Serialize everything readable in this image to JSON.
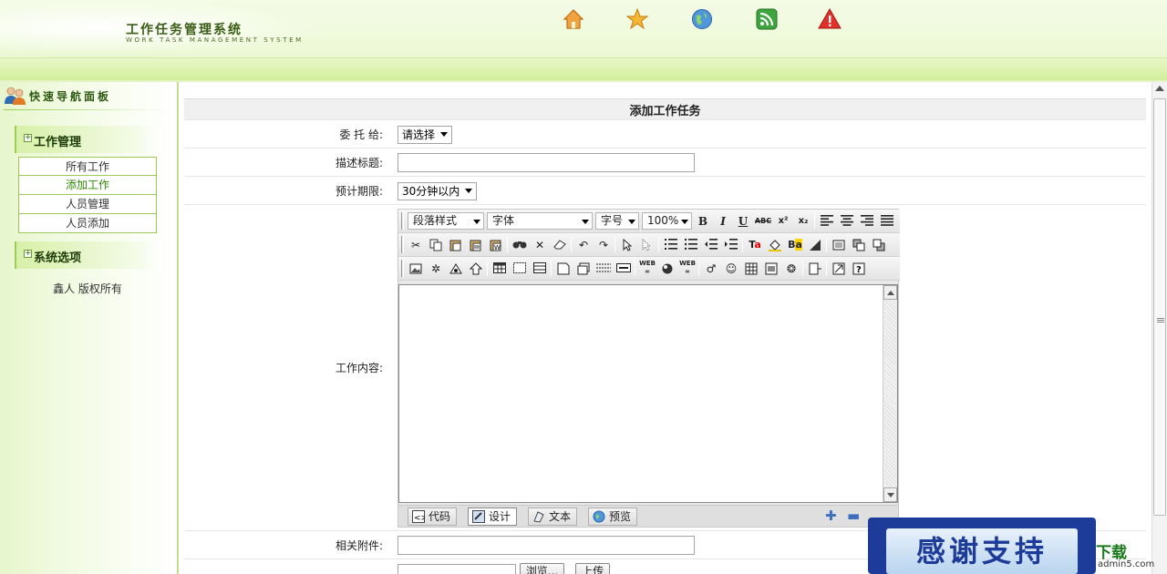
{
  "header": {
    "title": "工作任务管理系统",
    "subtitle": "WORK TASK MANAGEMENT SYSTEM",
    "icons": [
      "home-icon",
      "favorite-star-icon",
      "globe-icon",
      "rss-icon",
      "warning-icon"
    ]
  },
  "sidebar": {
    "title": "快速导航面板",
    "groups": [
      {
        "label": "工作管理",
        "items": [
          "所有工作",
          "添加工作",
          "人员管理",
          "人员添加"
        ],
        "active_index": 1
      },
      {
        "label": "系统选项"
      }
    ],
    "copyright": "鑫人 版权所有"
  },
  "form": {
    "caption": "添加工作任务",
    "assign_label": "委 托 给:",
    "assign_value": "请选择",
    "title_label": "描述标题:",
    "deadline_label": "预计期限:",
    "deadline_value": "30分钟以内",
    "content_label": "工作内容:",
    "attachment_label": "相关附件:"
  },
  "editor": {
    "paragraph_style": "段落样式",
    "font": "字体",
    "font_size": "字号",
    "zoom": "100%",
    "modes": [
      "代码",
      "设计",
      "文本",
      "预览"
    ],
    "active_mode": "设计"
  },
  "upload": {
    "browse_label": "浏览...",
    "upload_label": "上传"
  },
  "banner": {
    "text": "感谢支持",
    "watermark": "下载",
    "site": "admin5.com"
  },
  "colors": {
    "accent_green": "#9ccc55",
    "header_bg": "#eef9d8",
    "active_link": "#2e8b00"
  }
}
